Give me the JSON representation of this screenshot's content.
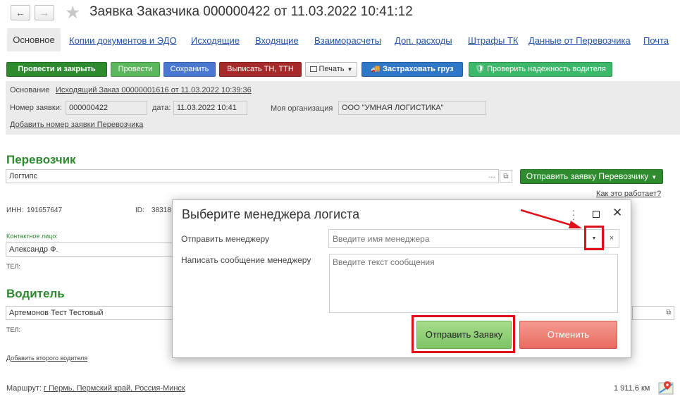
{
  "window": {
    "title": "Заявка Заказчика 000000422 от 11.03.2022 10:41:12",
    "back_icon": "←",
    "forward_icon": "→",
    "favorite_icon": "★"
  },
  "tabs": {
    "active": "Основное",
    "items": [
      "Копии документов и ЭДО",
      "Исходящие",
      "Входящие",
      "Взаиморасчеты",
      "Доп. расходы",
      "Штрафы ТК",
      "Данные от Перевозчика",
      "Почта"
    ]
  },
  "toolbar": {
    "post_close": "Провести и закрыть",
    "post": "Провести",
    "save": "Сохранить",
    "issue_docs": "Выписать ТН, ТТН",
    "print": "Печать",
    "insure": "Застраховать груз",
    "check_driver": "Проверить надежность водителя"
  },
  "header": {
    "basis_label": "Основание",
    "basis_link": "Исходящий Заказ 00000001616 от 11.03.2022 10:39:36",
    "number_label": "Номер заявки:",
    "number_value": "000000422",
    "date_label": "дата:",
    "date_value": "11.03.2022 10:41",
    "org_label": "Моя организация",
    "org_value": "ООО \"УМНАЯ ЛОГИСТИКА\"",
    "add_carrier_number": "Добавить номер заявки Перевозчика"
  },
  "carrier": {
    "title": "Перевозчик",
    "name": "Логтипс",
    "send_button": "Отправить заявку Перевозчику",
    "how_it_works": "Как это работает?",
    "inn_label": "ИНН:",
    "inn_value": "191657647",
    "id_label": "ID:",
    "id_value": "38318",
    "contact_label": "Контактное лицо:",
    "contact_value": "Александр Ф.",
    "phone_label": "ТЕЛ:"
  },
  "driver": {
    "title": "Водитель",
    "name": "Артемонов Тест Тестовый",
    "phone_label": "ТЕЛ:",
    "add_second": "Добавить второго водителя"
  },
  "route": {
    "label": "Маршрут:",
    "value": "г Пермь, Пермский край, Россия-Минск",
    "distance": "1 911,6 км"
  },
  "dialog": {
    "title": "Выберите менеджера логиста",
    "send_to_label": "Отправить менеджеру",
    "send_to_placeholder": "Введите имя менеджера",
    "message_label": "Написать сообщение менеджеру",
    "message_placeholder": "Введите текст сообщения",
    "submit": "Отправить Заявку",
    "cancel": "Отменить"
  },
  "colors": {
    "green_button": "#2e8b2e",
    "blue_button": "#4a78d0",
    "red_button": "#a52a2a",
    "section_green": "#2e8a2e",
    "link_blue": "#2353a6",
    "annotation_red": "#e0101a"
  }
}
